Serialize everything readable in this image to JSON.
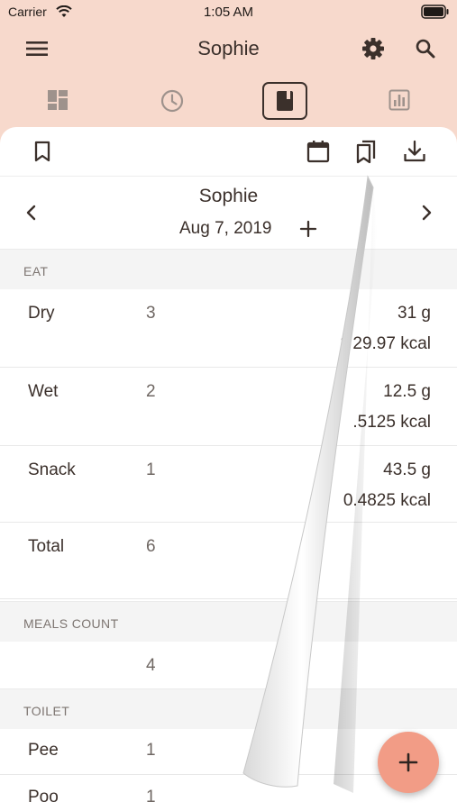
{
  "status_bar": {
    "carrier": "Carrier",
    "time": "1:05 AM"
  },
  "app_bar": {
    "title": "Sophie"
  },
  "tabs": [
    {
      "icon": "dashboard-icon",
      "active": false
    },
    {
      "icon": "clock-icon",
      "active": false
    },
    {
      "icon": "book-icon",
      "active": true
    },
    {
      "icon": "bar-chart-icon",
      "active": false
    }
  ],
  "toolbar": {
    "icons": [
      "bookmark-icon",
      "calendar-icon",
      "bookmarks-icon",
      "download-icon"
    ]
  },
  "day_header": {
    "name": "Sophie",
    "date": "Aug 7, 2019"
  },
  "sections": {
    "eat": "EAT",
    "meals_count": "MEALS COUNT",
    "toilet": "TOILET"
  },
  "eat_rows": [
    {
      "label": "Dry",
      "count": "3",
      "grams": "31 g",
      "kcal": "1 29.97 kcal"
    },
    {
      "label": "Wet",
      "count": "2",
      "grams": "12.5 g",
      "kcal": ".5125 kcal"
    },
    {
      "label": "Snack",
      "count": "1",
      "grams": "43.5 g",
      "kcal": "0.4825 kcal"
    }
  ],
  "eat_total": {
    "label": "Total",
    "count": "6"
  },
  "meals_count": {
    "value": "4"
  },
  "toilet_rows": [
    {
      "label": "Pee",
      "count": "1"
    },
    {
      "label": "Poo",
      "count": "1"
    }
  ],
  "colors": {
    "accent": "#f7d9cc",
    "fab": "#f29c86",
    "text": "#3b302b"
  }
}
